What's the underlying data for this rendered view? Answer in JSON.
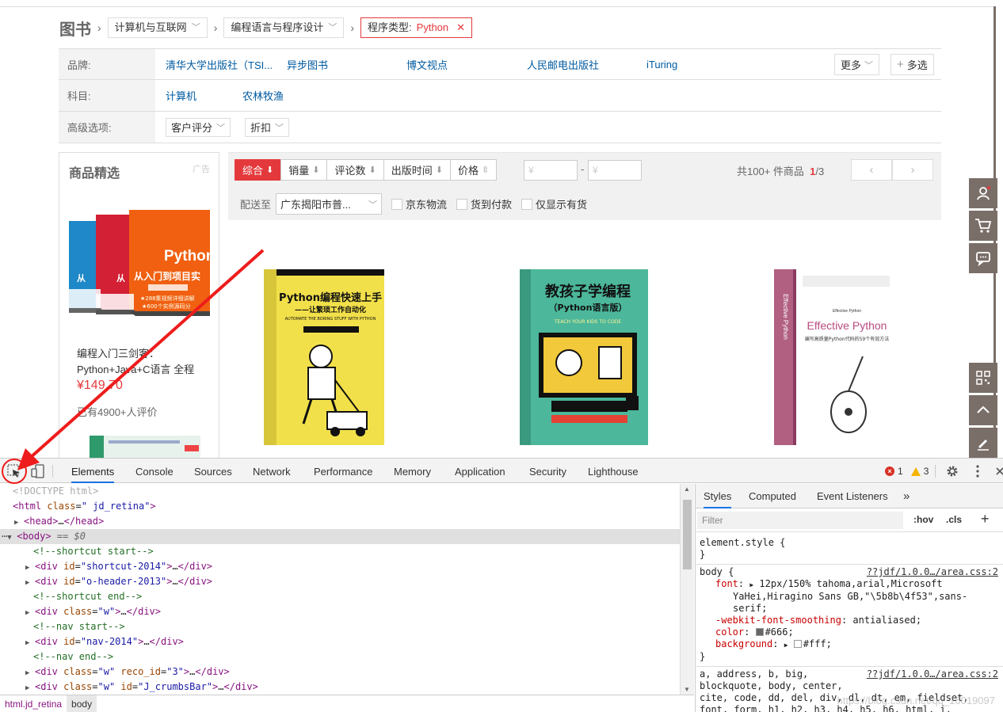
{
  "breadcrumb": {
    "root": "图书",
    "level1": "计算机与互联网",
    "level2": "编程语言与程序设计",
    "selected_label": "程序类型:",
    "selected_value": "Python",
    "remove_glyph": "✕"
  },
  "filters": {
    "brand_label": "品牌:",
    "brands": [
      "清华大学出版社（TSI...",
      "异步图书",
      "博文视点",
      "人民邮电出版社",
      "iTuring"
    ],
    "more_label": "更多",
    "multi_label": "多选",
    "subject_label": "科目:",
    "subjects": [
      "计算机",
      "农林牧渔"
    ],
    "advanced_label": "高级选项:",
    "advanced_options": [
      "客户评分",
      "折扣"
    ]
  },
  "promo": {
    "title": "商品精选",
    "ad_label": "广告",
    "name": "编程入门三剑客：Python+Java+C语言 全程",
    "price": "¥149.70",
    "comments": "已有4900+人评价",
    "cover_text": "Python 从入门到项目实践"
  },
  "sortbar": {
    "buttons": [
      "综合",
      "销量",
      "评论数",
      "出版时间",
      "价格"
    ],
    "price_from_placeholder": "¥",
    "price_to_placeholder": "¥",
    "price_dash": "-",
    "total_text": "共100+ 件商品",
    "page_current": "1",
    "page_total": "/3",
    "prev": "‹",
    "next": "›",
    "ship_to_label": "配送至",
    "ship_to_value": "广东揭阳市普...",
    "checkboxes": [
      "京东物流",
      "货到付款",
      "仅显示有货"
    ]
  },
  "books": [
    {
      "title": "Python编程快速上手",
      "subtitle": "——让繁琐工作自动化",
      "en": "AUTOMATE THE BORING STUFF WITH PYTHON"
    },
    {
      "title": "教孩子学编程",
      "subtitle": "（Python语言版）",
      "en": "TEACH YOUR KIDS TO CODE"
    },
    {
      "title": "Effective Python",
      "subtitle": "编写高质量Python代码的59个有效方法",
      "en": "Effective Python"
    }
  ],
  "devtools": {
    "tabs": [
      "Elements",
      "Console",
      "Sources",
      "Network",
      "Performance",
      "Memory",
      "Application",
      "Security",
      "Lighthouse"
    ],
    "errors": "1",
    "warnings": "3",
    "styles_tabs": [
      "Styles",
      "Computed",
      "Event Listeners",
      "»"
    ],
    "filter_placeholder": "Filter",
    "hov": ":hov",
    "cls": ".cls",
    "plus": "+",
    "breadcrumb": [
      "html.jd_retina",
      "body"
    ],
    "watermark": "https://blog.csdn.net/qq_16019097"
  }
}
